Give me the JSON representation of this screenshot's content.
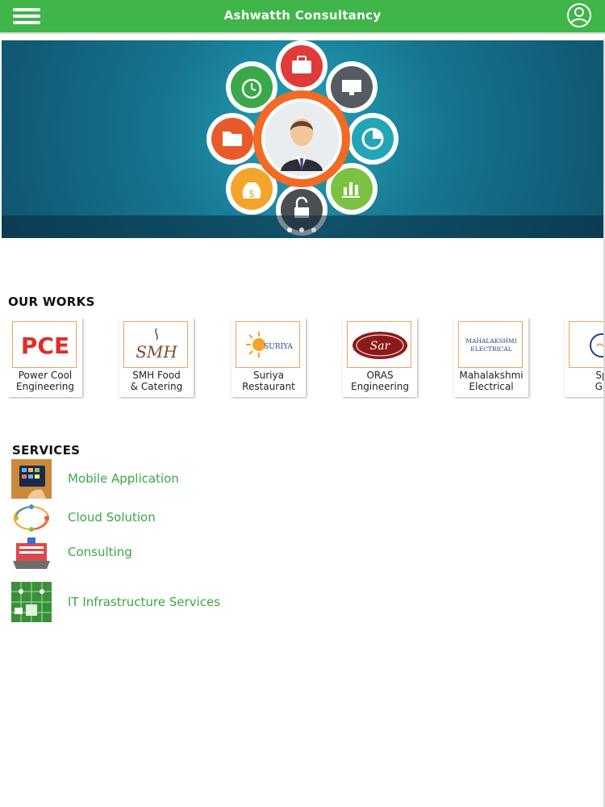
{
  "header": {
    "title": "Ashwatth Consultancy",
    "menu_icon": "hamburger-icon",
    "user_icon": "user-profile-icon",
    "bar_color": "#3fb54a"
  },
  "banner": {
    "slides_total": 3,
    "active_slide": 1,
    "hub_icons": [
      "alarm-clock-icon",
      "briefcase-icon",
      "monitor-icon",
      "pie-chart-icon",
      "bar-chart-icon",
      "lock-icon",
      "money-bag-icon",
      "folder-icon",
      "businessman-icon"
    ]
  },
  "works": {
    "heading": "OUR WORKS",
    "items": [
      {
        "line1": "Power Cool",
        "line2": "Engineering",
        "logo_text": "PCE"
      },
      {
        "line1": "SMH Food",
        "line2": "& Catering",
        "logo_text": "SMH"
      },
      {
        "line1": "Suriya",
        "line2": "Restaurant",
        "logo_text": "SURIYA"
      },
      {
        "line1": "ORAS",
        "line2": "Engineering",
        "logo_text": "Sar"
      },
      {
        "line1": "Mahalakshmi",
        "line2": "Electrical",
        "logo_text_1": "MAHALAKSHMI",
        "logo_text_2": "ELECTRICAL"
      },
      {
        "line1": "Sp",
        "line2": "Ga"
      }
    ]
  },
  "services": {
    "heading": "SERVICES",
    "items": [
      {
        "label": "Mobile Application",
        "icon": "mobile-app-thumbnail"
      },
      {
        "label": "Cloud Solution",
        "icon": "cloud-cycle-thumbnail"
      },
      {
        "label": "Consulting",
        "icon": "consulting-thumbnail"
      },
      {
        "label": "IT Infrastructure Services",
        "icon": "it-infrastructure-thumbnail"
      }
    ]
  }
}
